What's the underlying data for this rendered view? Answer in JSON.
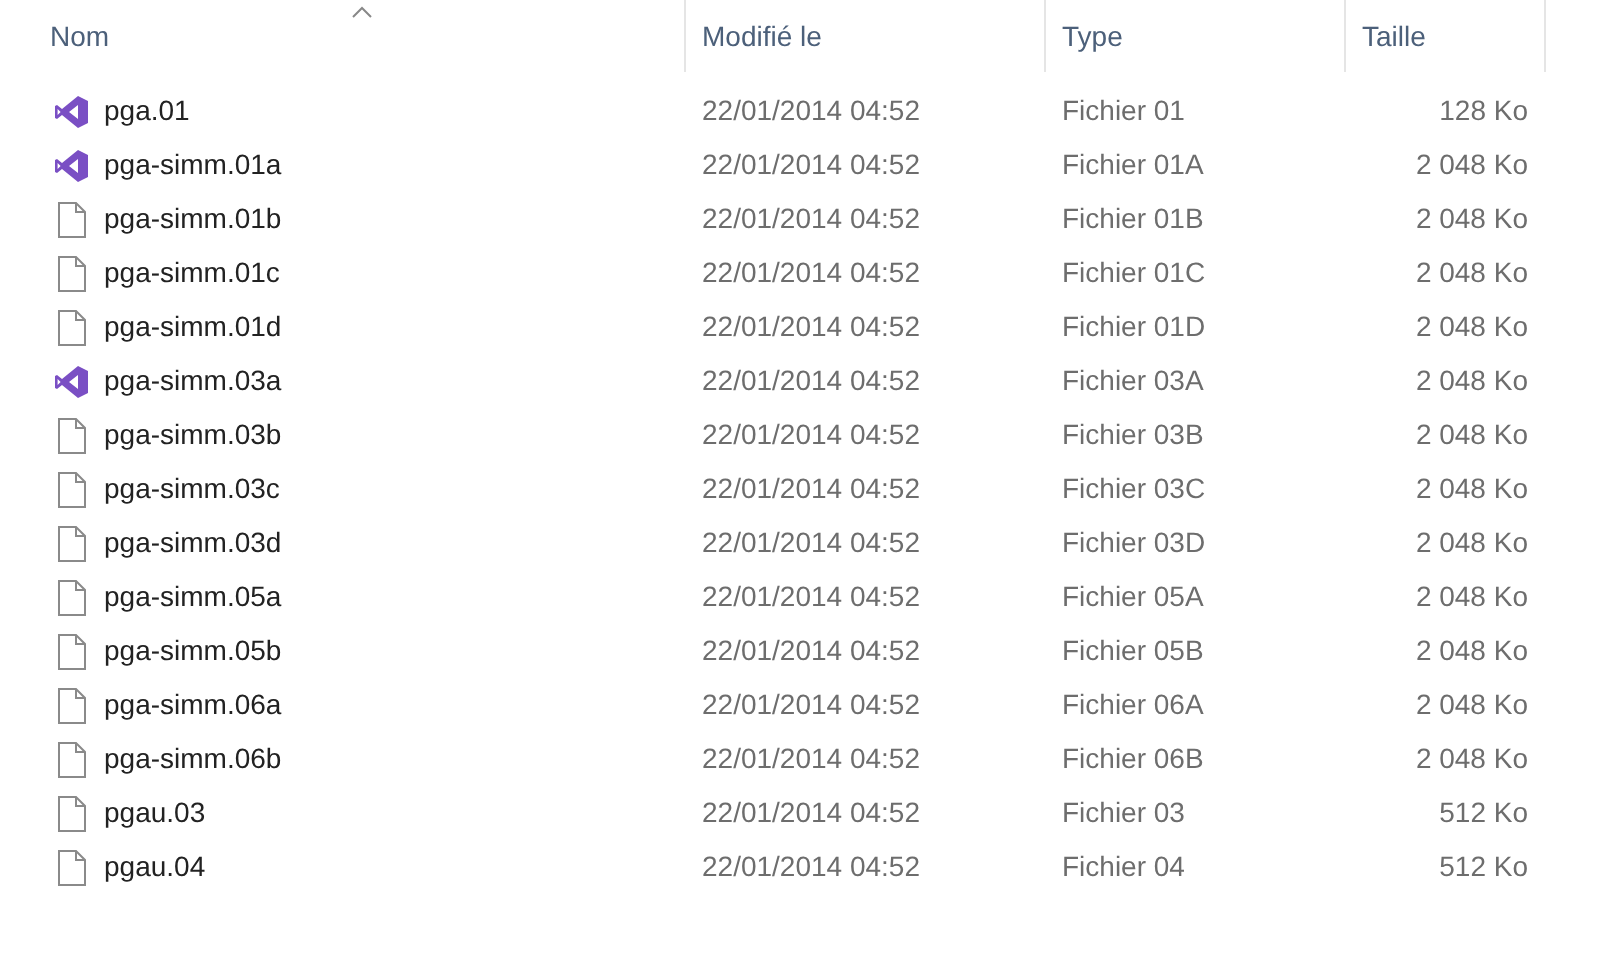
{
  "columns": [
    {
      "label": "Nom",
      "sorted": true
    },
    {
      "label": "Modifié le",
      "sorted": false
    },
    {
      "label": "Type",
      "sorted": false
    },
    {
      "label": "Taille",
      "sorted": false
    }
  ],
  "rows": [
    {
      "kind": "vs",
      "name": "pga.01",
      "modified": "22/01/2014 04:52",
      "type": "Fichier 01",
      "size": "128 Ko"
    },
    {
      "kind": "vs",
      "name": "pga-simm.01a",
      "modified": "22/01/2014 04:52",
      "type": "Fichier 01A",
      "size": "2 048 Ko"
    },
    {
      "kind": "file",
      "name": "pga-simm.01b",
      "modified": "22/01/2014 04:52",
      "type": "Fichier 01B",
      "size": "2 048 Ko"
    },
    {
      "kind": "file",
      "name": "pga-simm.01c",
      "modified": "22/01/2014 04:52",
      "type": "Fichier 01C",
      "size": "2 048 Ko"
    },
    {
      "kind": "file",
      "name": "pga-simm.01d",
      "modified": "22/01/2014 04:52",
      "type": "Fichier 01D",
      "size": "2 048 Ko"
    },
    {
      "kind": "vs",
      "name": "pga-simm.03a",
      "modified": "22/01/2014 04:52",
      "type": "Fichier 03A",
      "size": "2 048 Ko"
    },
    {
      "kind": "file",
      "name": "pga-simm.03b",
      "modified": "22/01/2014 04:52",
      "type": "Fichier 03B",
      "size": "2 048 Ko"
    },
    {
      "kind": "file",
      "name": "pga-simm.03c",
      "modified": "22/01/2014 04:52",
      "type": "Fichier 03C",
      "size": "2 048 Ko"
    },
    {
      "kind": "file",
      "name": "pga-simm.03d",
      "modified": "22/01/2014 04:52",
      "type": "Fichier 03D",
      "size": "2 048 Ko"
    },
    {
      "kind": "file",
      "name": "pga-simm.05a",
      "modified": "22/01/2014 04:52",
      "type": "Fichier 05A",
      "size": "2 048 Ko"
    },
    {
      "kind": "file",
      "name": "pga-simm.05b",
      "modified": "22/01/2014 04:52",
      "type": "Fichier 05B",
      "size": "2 048 Ko"
    },
    {
      "kind": "file",
      "name": "pga-simm.06a",
      "modified": "22/01/2014 04:52",
      "type": "Fichier 06A",
      "size": "2 048 Ko"
    },
    {
      "kind": "file",
      "name": "pga-simm.06b",
      "modified": "22/01/2014 04:52",
      "type": "Fichier 06B",
      "size": "2 048 Ko"
    },
    {
      "kind": "file",
      "name": "pgau.03",
      "modified": "22/01/2014 04:52",
      "type": "Fichier 03",
      "size": "512 Ko"
    },
    {
      "kind": "file",
      "name": "pgau.04",
      "modified": "22/01/2014 04:52",
      "type": "Fichier 04",
      "size": "512 Ko"
    }
  ]
}
